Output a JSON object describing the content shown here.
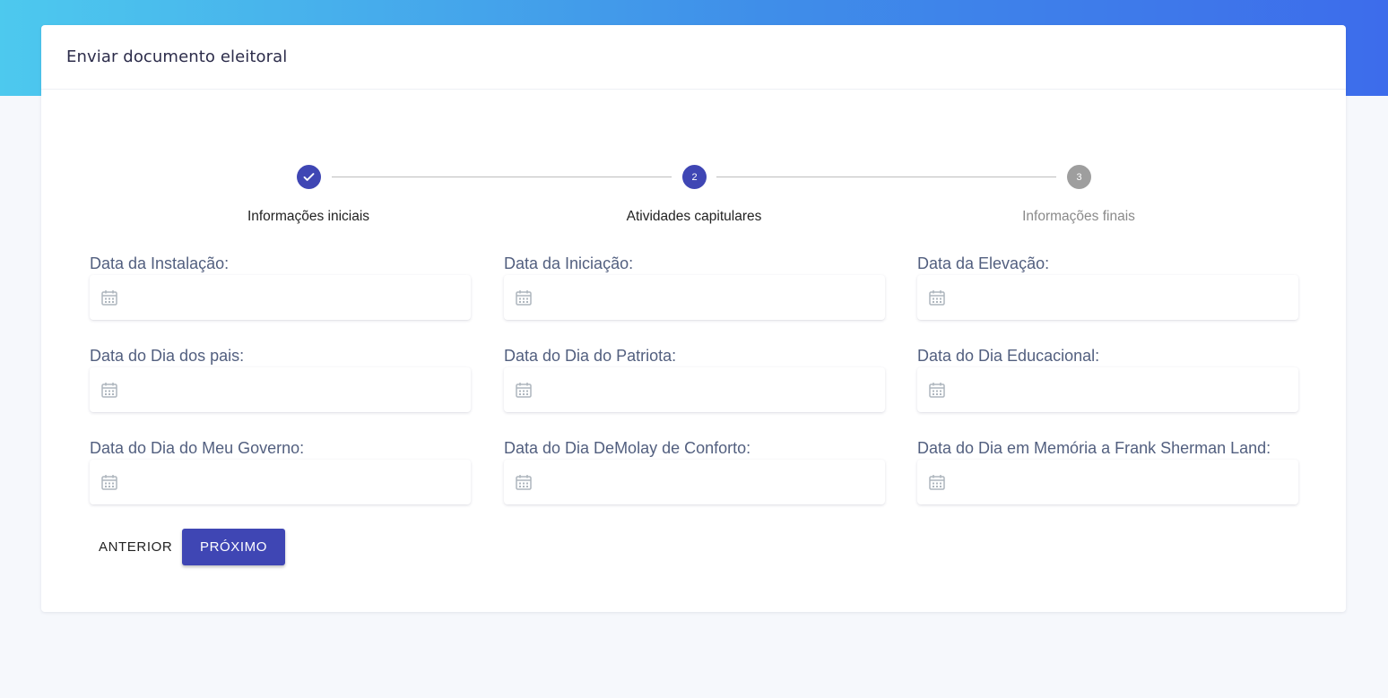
{
  "card": {
    "title": "Enviar documento eleitoral"
  },
  "stepper": {
    "steps": [
      {
        "number": "1",
        "label": "Informações iniciais",
        "state": "completed",
        "icon": "check-icon"
      },
      {
        "number": "2",
        "label": "Atividades capitulares",
        "state": "active"
      },
      {
        "number": "3",
        "label": "Informações finais",
        "state": "pending"
      }
    ]
  },
  "form": {
    "fields": [
      {
        "label": "Data da Instalação:",
        "value": "",
        "icon": "calendar-icon"
      },
      {
        "label": "Data da Iniciação:",
        "value": "",
        "icon": "calendar-icon"
      },
      {
        "label": "Data da Elevação:",
        "value": "",
        "icon": "calendar-icon"
      },
      {
        "label": "Data do Dia dos pais:",
        "value": "",
        "icon": "calendar-icon"
      },
      {
        "label": "Data do Dia do Patriota:",
        "value": "",
        "icon": "calendar-icon"
      },
      {
        "label": "Data do Dia Educacional:",
        "value": "",
        "icon": "calendar-icon"
      },
      {
        "label": "Data do Dia do Meu Governo:",
        "value": "",
        "icon": "calendar-icon"
      },
      {
        "label": "Data do Dia DeMolay de Conforto:",
        "value": "",
        "icon": "calendar-icon"
      },
      {
        "label": "Data do Dia em Memória a Frank Sherman Land:",
        "value": "",
        "icon": "calendar-icon"
      }
    ]
  },
  "actions": {
    "prev_label": "Anterior",
    "next_label": "Próximo"
  },
  "colors": {
    "primary": "#3f46b4",
    "pending_step": "#9e9e9e",
    "label_text": "#525f7f",
    "header_gradient_start": "#4dc9ee",
    "header_gradient_end": "#3d6ceb",
    "page_background": "#f6f8fc"
  }
}
